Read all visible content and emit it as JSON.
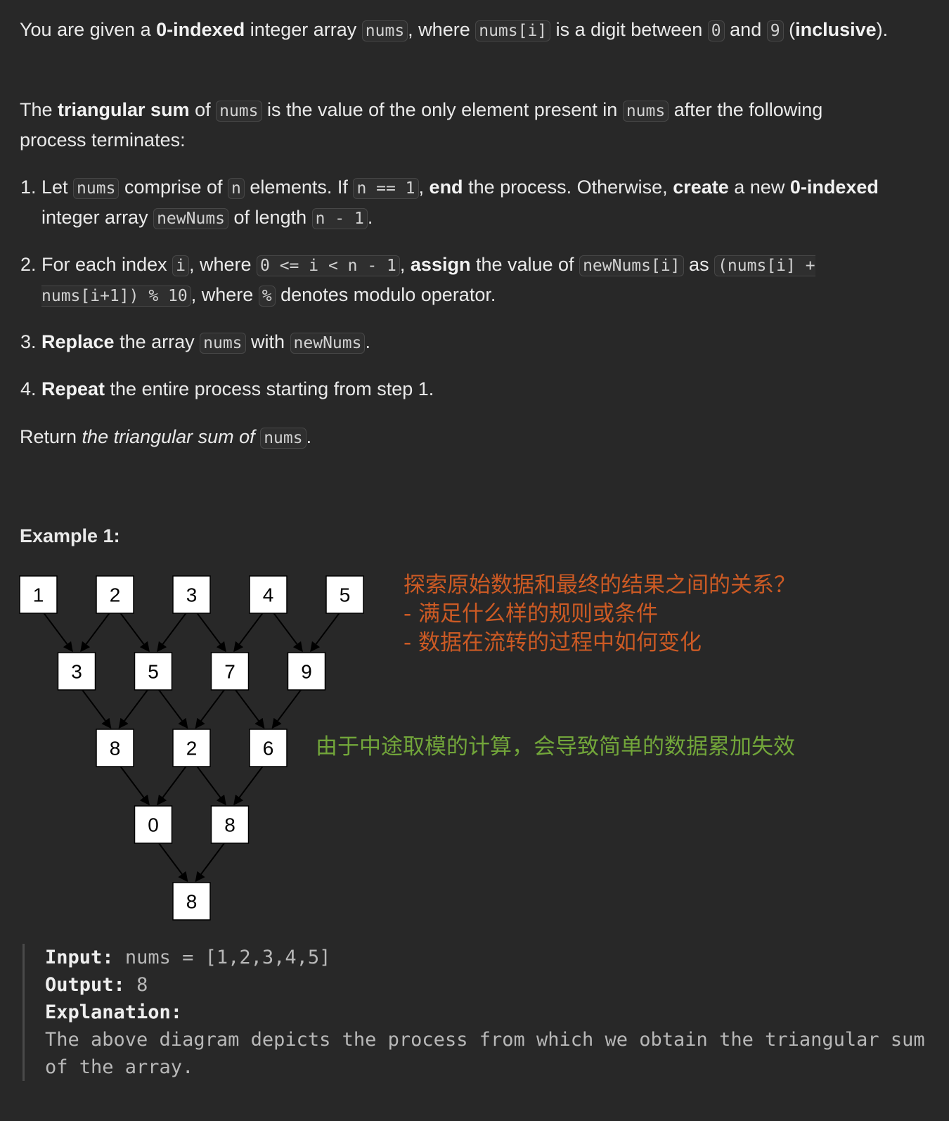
{
  "intro": {
    "p1_a": "You are given a ",
    "p1_b": "0-indexed",
    "p1_c": " integer array ",
    "p1_code1": "nums",
    "p1_d": ", where ",
    "p1_code2": "nums[i]",
    "p1_e": " is a digit between ",
    "p1_code3": "0",
    "p1_f": " and ",
    "p1_code4": "9",
    "p1_g": " (",
    "p1_h": "inclusive",
    "p1_i": ").",
    "p2_a": "The ",
    "p2_b": "triangular sum",
    "p2_c": " of ",
    "p2_code1": "nums",
    "p2_d": " is the value of the only element present in ",
    "p2_code2": "nums",
    "p2_e": " after the following process terminates:"
  },
  "steps": {
    "s1_a": "Let ",
    "s1_code1": "nums",
    "s1_b": " comprise of ",
    "s1_code2": "n",
    "s1_c": " elements. If ",
    "s1_code3": "n == 1",
    "s1_d": ", ",
    "s1_e": "end",
    "s1_f": " the process. Otherwise, ",
    "s1_g": "create",
    "s1_h": " a new ",
    "s1_i": "0-indexed",
    "s1_j": " integer array ",
    "s1_code4": "newNums",
    "s1_k": " of length ",
    "s1_code5": "n - 1",
    "s1_l": ".",
    "s2_a": "For each index ",
    "s2_code1": "i",
    "s2_b": ", where ",
    "s2_code2": "0 <= i < n - 1",
    "s2_c": ", ",
    "s2_d": "assign",
    "s2_e": " the value of ",
    "s2_code3": "newNums[i]",
    "s2_f": " as ",
    "s2_code4": "(nums[i] + nums[i+1]) % 10",
    "s2_g": ", where ",
    "s2_code5": "%",
    "s2_h": " denotes modulo operator.",
    "s3_a": "Replace",
    "s3_b": " the array ",
    "s3_code1": "nums",
    "s3_c": " with ",
    "s3_code2": "newNums",
    "s3_d": ".",
    "s4_a": "Repeat",
    "s4_b": " the entire process starting from step 1."
  },
  "return_line": {
    "a": "Return ",
    "b": "the triangular sum of ",
    "code": "nums",
    "c": "."
  },
  "example": {
    "title": "Example 1:",
    "rows": [
      [
        "1",
        "2",
        "3",
        "4",
        "5"
      ],
      [
        "3",
        "5",
        "7",
        "9"
      ],
      [
        "8",
        "2",
        "6"
      ],
      [
        "0",
        "8"
      ],
      [
        "8"
      ]
    ],
    "input_label": "Input:",
    "input_value": "nums = [1,2,3,4,5]",
    "output_label": "Output:",
    "output_value": "8",
    "explanation_label": "Explanation:",
    "explanation_text": "The above diagram depicts the process from which we obtain the triangular sum of the array."
  },
  "annotations": {
    "red_lines": [
      "探索原始数据和最终的结果之间的关系？",
      "- 满足什么样的规则或条件",
      "- 数据在流转的过程中如何变化"
    ],
    "red_color": "#cc5a24",
    "green_text": "由于中途取模的计算，会导致简单的数据累加失效",
    "green_color": "#72a63a"
  }
}
